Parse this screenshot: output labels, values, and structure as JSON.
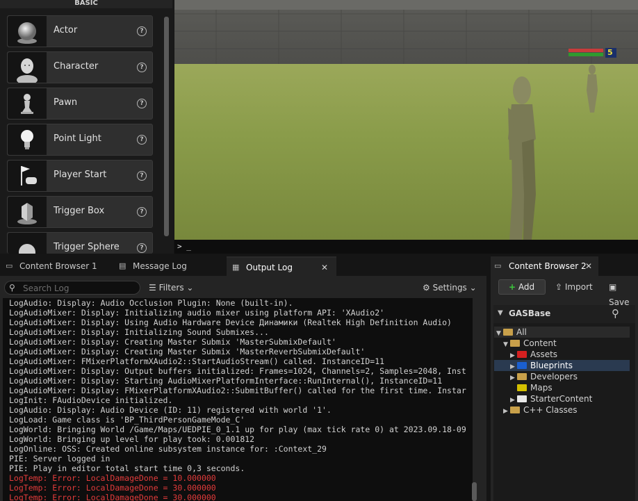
{
  "place_actors": {
    "category": "BASIC",
    "items": [
      {
        "label": "Actor",
        "icon": "sphere-icon"
      },
      {
        "label": "Character",
        "icon": "character-icon"
      },
      {
        "label": "Pawn",
        "icon": "pawn-icon"
      },
      {
        "label": "Point Light",
        "icon": "light-bulb-icon"
      },
      {
        "label": "Player Start",
        "icon": "player-start-icon"
      },
      {
        "label": "Trigger Box",
        "icon": "trigger-box-icon"
      },
      {
        "label": "Trigger Sphere",
        "icon": "trigger-sphere-icon"
      }
    ],
    "help_glyph": "?"
  },
  "viewport": {
    "health_level": "5",
    "console_prompt": "> _"
  },
  "tabs": [
    {
      "label": "Content Browser 1",
      "icon": "folder-icon"
    },
    {
      "label": "Message Log",
      "icon": "message-log-icon"
    },
    {
      "label": "Output Log",
      "icon": "output-log-icon",
      "active": true
    }
  ],
  "output_log": {
    "search_placeholder": "Search Log",
    "filters_label": "Filters",
    "settings_label": "Settings",
    "lines": [
      {
        "text": "LogAudio: Display: Audio Occlusion Plugin: None (built-in).",
        "error": false
      },
      {
        "text": "LogAudioMixer: Display: Initializing audio mixer using platform API: 'XAudio2'",
        "error": false
      },
      {
        "text": "LogAudioMixer: Display: Using Audio Hardware Device Динамики (Realtek High Definition Audio)",
        "error": false
      },
      {
        "text": "LogAudioMixer: Display: Initializing Sound Submixes...",
        "error": false
      },
      {
        "text": "LogAudioMixer: Display: Creating Master Submix 'MasterSubmixDefault'",
        "error": false
      },
      {
        "text": "LogAudioMixer: Display: Creating Master Submix 'MasterReverbSubmixDefault'",
        "error": false
      },
      {
        "text": "LogAudioMixer: FMixerPlatformXAudio2::StartAudioStream() called. InstanceID=11",
        "error": false
      },
      {
        "text": "LogAudioMixer: Display: Output buffers initialized: Frames=1024, Channels=2, Samples=2048, Inst",
        "error": false
      },
      {
        "text": "LogAudioMixer: Display: Starting AudioMixerPlatformInterface::RunInternal(), InstanceID=11",
        "error": false
      },
      {
        "text": "LogAudioMixer: Display: FMixerPlatformXAudio2::SubmitBuffer() called for the first time. Instar",
        "error": false
      },
      {
        "text": "LogInit: FAudioDevice initialized.",
        "error": false
      },
      {
        "text": "LogAudio: Display: Audio Device (ID: 11) registered with world '1'.",
        "error": false
      },
      {
        "text": "LogLoad: Game class is 'BP_ThirdPersonGameMode_C'",
        "error": false
      },
      {
        "text": "LogWorld: Bringing World /Game/Maps/UEDPIE_0_1.1 up for play (max tick rate 0) at 2023.09.18-09",
        "error": false
      },
      {
        "text": "LogWorld: Bringing up level for play took: 0.001812",
        "error": false
      },
      {
        "text": "LogOnline: OSS: Created online subsystem instance for: :Context_29",
        "error": false
      },
      {
        "text": "PIE: Server logged in",
        "error": false
      },
      {
        "text": "PIE: Play in editor total start time 0,3 seconds.",
        "error": false
      },
      {
        "text": "LogTemp: Error: LocalDamageDone = 10.000000",
        "error": true
      },
      {
        "text": "LogTemp: Error: LocalDamageDone = 30.000000",
        "error": true
      },
      {
        "text": "LogTemp: Error: LocalDamageDone = 30.000000",
        "error": true
      }
    ]
  },
  "content_browser_2": {
    "tab_label": "Content Browser 2",
    "add_label": "Add",
    "import_label": "Import",
    "save_label": "Save",
    "project_name": "GASBase",
    "tree": [
      {
        "label": "All",
        "depth": 0,
        "expanded": true,
        "color": "#c8a04a"
      },
      {
        "label": "Content",
        "depth": 1,
        "expanded": true,
        "color": "#c8a04a"
      },
      {
        "label": "Assets",
        "depth": 2,
        "expanded": false,
        "color": "#d42020"
      },
      {
        "label": "Blueprints",
        "depth": 2,
        "expanded": false,
        "color": "#1a5fd0",
        "selected": true
      },
      {
        "label": "Developers",
        "depth": 2,
        "expanded": false,
        "color": "#c8a04a"
      },
      {
        "label": "Maps",
        "depth": 2,
        "expanded": null,
        "color": "#d4c000"
      },
      {
        "label": "StarterContent",
        "depth": 2,
        "expanded": false,
        "color": "#e8e8e8"
      },
      {
        "label": "C++ Classes",
        "depth": 1,
        "expanded": false,
        "color": "#c8a04a"
      }
    ]
  },
  "colors": {
    "error_text": "#e33b3b",
    "selected_row": "#2a3a50",
    "add_icon": "#3cc83c"
  }
}
